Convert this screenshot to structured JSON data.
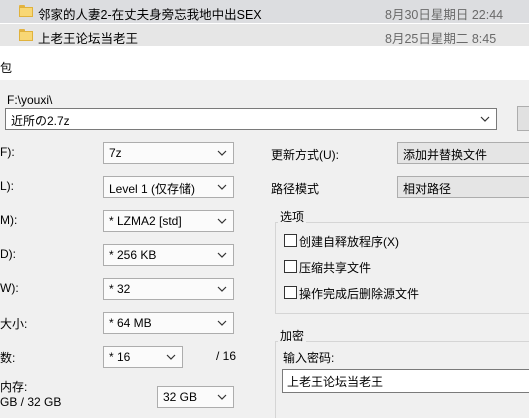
{
  "file_list": {
    "rows": [
      {
        "name": "邻家的人妻2-在丈夫身旁忘我地中出SEX",
        "date": "8月30日星期日 22:44"
      },
      {
        "name": "上老王论坛当老王",
        "date": "8月25日星期二 8:45"
      }
    ]
  },
  "dialog": {
    "title": "包",
    "path": "F:\\youxi\\",
    "archive_name": "近所の2.7z",
    "left_fields": [
      {
        "label": "F):",
        "value": "7z"
      },
      {
        "label": "L):",
        "value": "Level 1 (仅存储)"
      },
      {
        "label": "M):",
        "value": "* LZMA2 [std]"
      },
      {
        "label": "D):",
        "value": "* 256 KB"
      },
      {
        "label": "W):",
        "value": "* 32"
      },
      {
        "label": "大小:",
        "value": "* 64 MB"
      },
      {
        "label": "数:",
        "value": "* 16"
      }
    ],
    "threads_total": "/ 16",
    "memory_label": "内存:",
    "memory_usage": "GB / 32 GB",
    "memory_limit": "32 GB",
    "update_mode": {
      "label": "更新方式(U):",
      "value": "添加并替换文件"
    },
    "path_mode": {
      "label": "路径模式",
      "value": "相对路径"
    },
    "options": {
      "legend": "选项",
      "items": [
        {
          "label": "创建自释放程序(X)",
          "checked": false
        },
        {
          "label": "压缩共享文件",
          "checked": false
        },
        {
          "label": "操作完成后删除源文件",
          "checked": false
        }
      ]
    },
    "encryption": {
      "legend": "加密",
      "password_label": "输入密码:",
      "password": "上老王论坛当老王"
    }
  },
  "colors": {
    "dialog_bg": "#f0f0f0",
    "folder": "#f8d775"
  }
}
